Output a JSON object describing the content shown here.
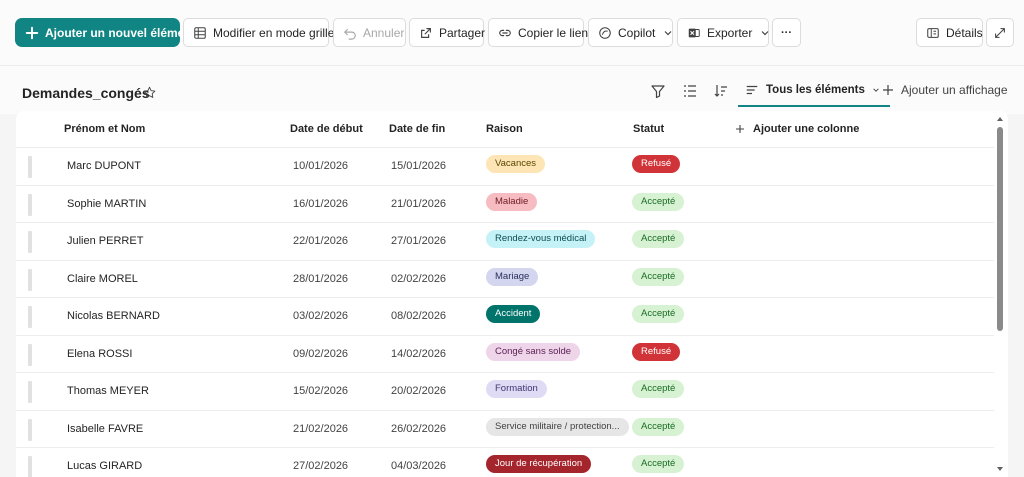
{
  "toolbar": {
    "add_item": "Ajouter un nouvel élément",
    "edit_grid": "Modifier en mode grille",
    "undo": "Annuler",
    "share": "Partager",
    "copy_link": "Copier le lien",
    "copilot": "Copilot",
    "export": "Exporter",
    "more": "···",
    "details": "Détails"
  },
  "list": {
    "title": "Demandes_congés",
    "view_name": "Tous les éléments",
    "add_view": "Ajouter un affichage"
  },
  "columns": {
    "name": "Prénom et Nom",
    "start": "Date de début",
    "end": "Date de fin",
    "reason": "Raison",
    "status": "Statut",
    "add_column": "Ajouter une colonne"
  },
  "colors": {
    "accent": "#108583"
  },
  "rows": [
    {
      "name": "Marc DUPONT",
      "start": "10/01/2026",
      "end": "15/01/2026",
      "reason": "Vacances",
      "reason_bg": "#fde5b6",
      "reason_fg": "#5c4700",
      "status": "Refusé",
      "status_kind": "refused"
    },
    {
      "name": "Sophie MARTIN",
      "start": "16/01/2026",
      "end": "21/01/2026",
      "reason": "Maladie",
      "reason_bg": "#f6bcc1",
      "reason_fg": "#6d1b22",
      "status": "Accepté",
      "status_kind": "accepted"
    },
    {
      "name": "Julien PERRET",
      "start": "22/01/2026",
      "end": "27/01/2026",
      "reason": "Rendez-vous médical",
      "reason_bg": "#c5f2f6",
      "reason_fg": "#0b4d54",
      "status": "Accepté",
      "status_kind": "accepted"
    },
    {
      "name": "Claire MOREL",
      "start": "28/01/2026",
      "end": "02/02/2026",
      "reason": "Mariage",
      "reason_bg": "#d4d6ef",
      "reason_fg": "#2c2f5a",
      "status": "Accepté",
      "status_kind": "accepted"
    },
    {
      "name": "Nicolas BERNARD",
      "start": "03/02/2026",
      "end": "08/02/2026",
      "reason": "Accident",
      "reason_bg": "#00736b",
      "reason_fg": "#ffffff",
      "status": "Accepté",
      "status_kind": "accepted"
    },
    {
      "name": "Elena ROSSI",
      "start": "09/02/2026",
      "end": "14/02/2026",
      "reason": "Congé sans solde",
      "reason_bg": "#eed5ea",
      "reason_fg": "#5a1f50",
      "status": "Refusé",
      "status_kind": "refused"
    },
    {
      "name": "Thomas MEYER",
      "start": "15/02/2026",
      "end": "20/02/2026",
      "reason": "Formation",
      "reason_bg": "#e0dbf5",
      "reason_fg": "#3e3570",
      "status": "Accepté",
      "status_kind": "accepted"
    },
    {
      "name": "Isabelle FAVRE",
      "start": "21/02/2026",
      "end": "26/02/2026",
      "reason": "Service militaire / protection...",
      "reason_bg": "#e6e6e6",
      "reason_fg": "#424242",
      "status": "Accepté",
      "status_kind": "accepted"
    },
    {
      "name": "Lucas GIRARD",
      "start": "27/02/2026",
      "end": "04/03/2026",
      "reason": "Jour de récupération",
      "reason_bg": "#a4262c",
      "reason_fg": "#ffffff",
      "status": "Accepté",
      "status_kind": "accepted"
    }
  ],
  "status_colors": {
    "refused_bg": "#d13438",
    "refused_fg": "#ffffff",
    "accepted_bg": "#d7f2d2",
    "accepted_fg": "#196b24"
  },
  "icons": [
    "plus-icon",
    "grid-icon",
    "undo-icon",
    "share-icon",
    "link-icon",
    "copilot-icon",
    "export-icon",
    "more-icon",
    "details-icon",
    "expand-icon",
    "star-icon",
    "filter-icon",
    "group-icon",
    "sort-icon",
    "view-list-icon",
    "chevron-down-icon"
  ]
}
